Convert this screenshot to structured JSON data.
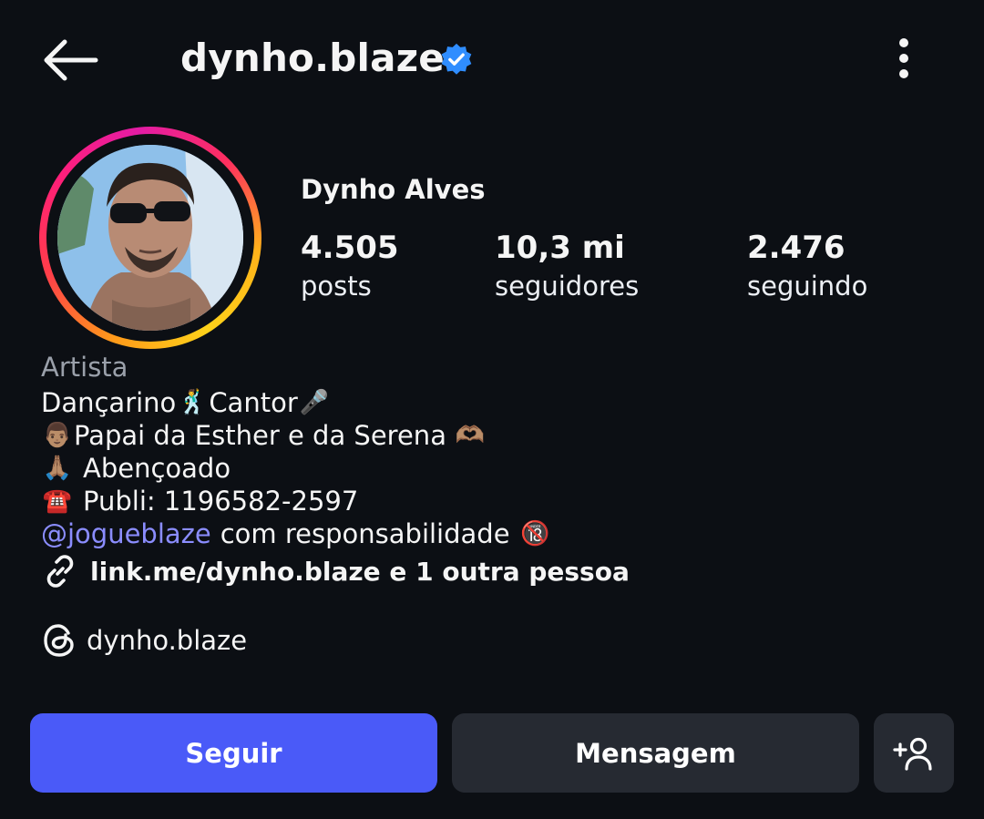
{
  "header": {
    "username": "dynho.blaze",
    "back_icon": "arrow-left-icon",
    "verified_icon": "verified-badge-icon",
    "more_icon": "more-vertical-icon"
  },
  "profile": {
    "full_name": "Dynho Alves",
    "avatar": "profile-photo"
  },
  "stats": [
    {
      "value": "4.505",
      "label": "posts"
    },
    {
      "value": "10,3 mi",
      "label": "seguidores"
    },
    {
      "value": "2.476",
      "label": "seguindo"
    }
  ],
  "bio": {
    "category": "Artista",
    "line1_a": "Dançarino",
    "line1_emoji_a": "🕺",
    "line1_b": "Cantor",
    "line1_emoji_b": "🎤",
    "line2_emoji": "👨🏽",
    "line2_text": "Papai da Esther e da Serena",
    "line2_emoji_end": "🫶🏽",
    "line3_emoji": "🙏🏽",
    "line3_text": "Abençoado",
    "line4_emoji": "☎️",
    "line4_text": "Publi: 1196582-2597",
    "line5_mention": "@jogueblaze",
    "line5_text": "com responsabilidade",
    "line5_emoji": "🔞",
    "link_text": "link.me/dynho.blaze e 1 outra pessoa",
    "threads_handle": "dynho.blaze"
  },
  "actions": {
    "follow_label": "Seguir",
    "message_label": "Mensagem",
    "add_person_icon": "add-person-icon"
  },
  "colors": {
    "background": "#0c0f14",
    "follow_button": "#4a5af8",
    "secondary_button": "#262a32",
    "verified": "#2f8dff",
    "mention": "#8b8dff",
    "muted_text": "#9aa0aa"
  }
}
